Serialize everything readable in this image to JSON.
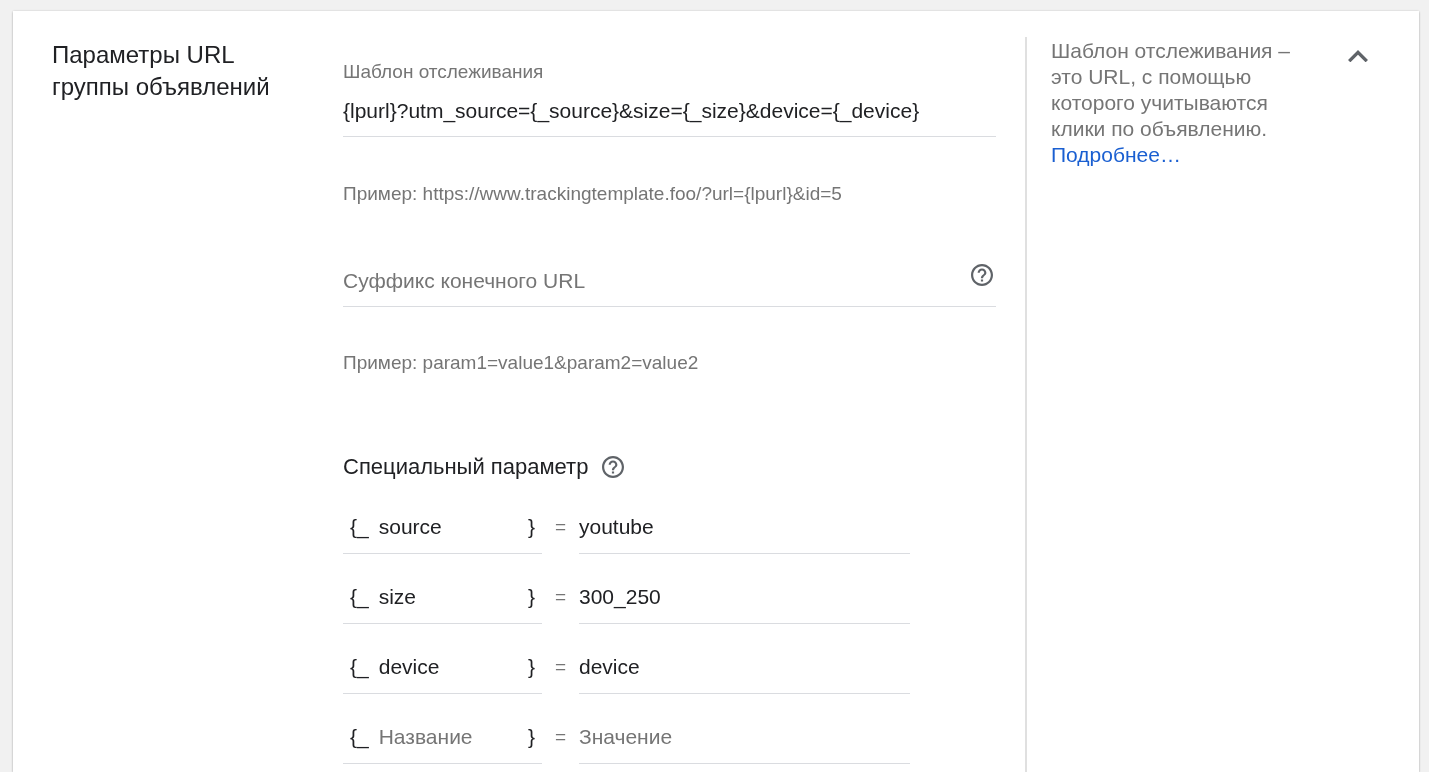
{
  "section": {
    "title": "Параметры URL группы объявлений",
    "expanded": true
  },
  "tracking_template": {
    "label": "Шаблон отслеживания",
    "value": "{lpurl}?utm_source={_source}&size={_size}&device={_device}",
    "example": "Пример: https://www.trackingtemplate.foo/?url={lpurl}&id=5"
  },
  "final_url_suffix": {
    "placeholder": "Суффикс конечного URL",
    "example": "Пример: param1=value1&param2=value2"
  },
  "custom_parameters": {
    "title": "Специальный параметр",
    "rows": [
      {
        "prefix": "{_",
        "name": "source",
        "suffix": "}",
        "equals": "=",
        "value": "youtube"
      },
      {
        "prefix": "{_",
        "name": "size",
        "suffix": "}",
        "equals": "=",
        "value": "300_250"
      },
      {
        "prefix": "{_",
        "name": "device",
        "suffix": "}",
        "equals": "=",
        "value": "device"
      },
      {
        "prefix": "{_",
        "name_placeholder": "Название",
        "suffix": "}",
        "equals": "=",
        "value_placeholder": "Значение"
      }
    ]
  },
  "help": {
    "text": "Шаблон отслеживания – это URL, с помощью которого учитываются клики по объявлению.",
    "link": "Подробнее…"
  }
}
